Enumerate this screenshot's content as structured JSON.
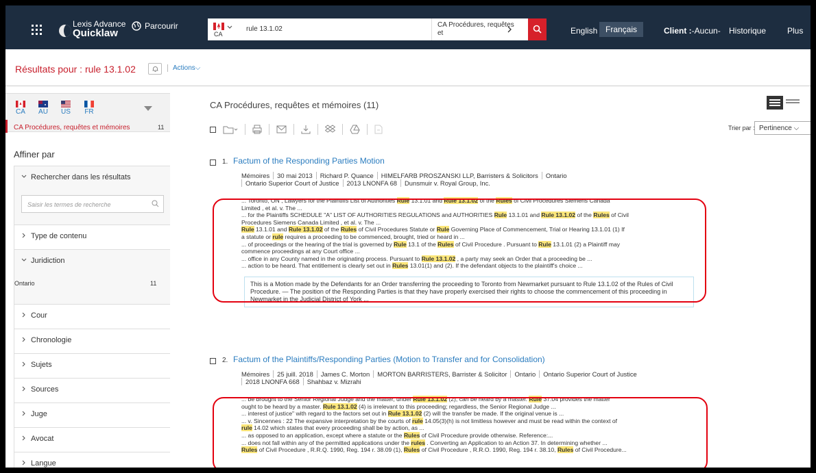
{
  "header": {
    "logo_line1": "Lexis Advance",
    "logo_line2": "Quicklaw",
    "browse": "Parcourir",
    "search_country": "CA",
    "search_query": "rule 13.1.02",
    "source_label": "CA Procédures, requêtes et",
    "lang_en": "English",
    "lang_fr": "Français",
    "client_label": "Client :",
    "client_value": "-Aucun-",
    "history": "Historique",
    "more": "Plus"
  },
  "results_bar": {
    "title": "Résultats pour : rule 13.1.02",
    "actions": "Actions"
  },
  "jurisdictions": [
    {
      "code": "CA"
    },
    {
      "code": "AU"
    },
    {
      "code": "US"
    },
    {
      "code": "FR"
    }
  ],
  "collection": {
    "label": "CA Procédures, requêtes et mémoires",
    "count": "11"
  },
  "refine": {
    "title": "Affiner par",
    "search_within": "Rechercher dans les résultats",
    "search_placeholder": "Saisir les termes de recherche",
    "facets": [
      "Type de contenu",
      "Juridiction",
      "Cour",
      "Chronologie",
      "Sujets",
      "Sources",
      "Juge",
      "Avocat",
      "Langue"
    ],
    "jurisdiction_value": "Ontario",
    "jurisdiction_count": "11"
  },
  "main": {
    "title": "CA Procédures, requêtes et mémoires (11)",
    "sort_label": "Trier par :",
    "sort_value": "Pertinence"
  },
  "results": [
    {
      "num": "1.",
      "title": "Factum of the Responding Parties Motion",
      "meta": [
        "Mémoires",
        "30 mai 2013",
        "Richard P. Quance",
        "HIMELFARB PROSZANSKI LLP, Barristers & Solicitors",
        "Ontario"
      ],
      "meta2": [
        "Ontario Superior Court of Justice",
        "2013 LNONFA 68",
        "Dunsmuir v. Royal Group, Inc."
      ],
      "summary": "This is a Motion made by the Defendants for an Order transferring the proceeding to Toronto from Newmarket pursuant to Rule 13.1.02 of the Rules of Civil Procedure. — The position of the Responding Parties is that they have properly exercised their rights to choose the commencement of this proceeding in Newmarket in the Judicial District of York ..."
    },
    {
      "num": "2.",
      "title": "Factum of the Plaintiffs/Responding Parties (Motion to Transfer and for Consolidation)",
      "meta": [
        "Mémoires",
        "25 juill. 2018",
        "James C. Morton",
        "MORTON BARRISTERS, Barrister & Solicitor",
        "Ontario",
        "Ontario Superior Court of Justice"
      ],
      "meta2": [
        "2018 LNONFA 668",
        "Shahbaz v. Mizrahi"
      ]
    }
  ]
}
